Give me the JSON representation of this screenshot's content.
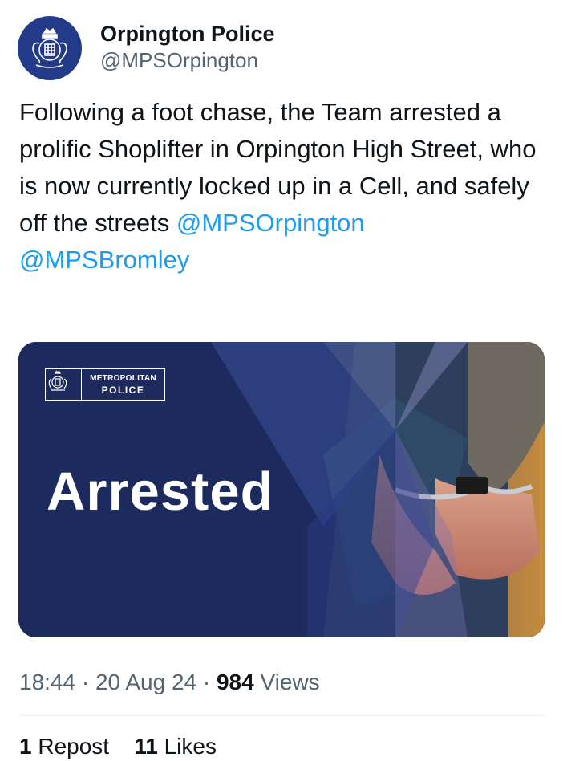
{
  "account": {
    "display_name": "Orpington Police",
    "handle": "@MPSOrpington",
    "avatar_icon": "met-police-crest-icon"
  },
  "tweet": {
    "text": "Following a foot chase, the Team arrested a prolific Shoplifter in Orpington High Street, who is now currently locked up in a Cell, and safely off the streets ",
    "mentions": [
      "@MPSOrpington",
      "@MPSBromley"
    ]
  },
  "media": {
    "logo_line1": "METROPOLITAN",
    "logo_line2": "POLICE",
    "headline": "Arrested",
    "background_color": "#1d2a5e"
  },
  "meta": {
    "time": "18:44",
    "separator": " · ",
    "date": "20 Aug 24",
    "views_count": "984",
    "views_label": " Views"
  },
  "stats": {
    "reposts_count": "1",
    "reposts_label": "Repost",
    "likes_count": "11",
    "likes_label": "Likes"
  },
  "colors": {
    "link": "#1d9bf0",
    "secondary_text": "#536471",
    "primary_text": "#0f1419"
  }
}
